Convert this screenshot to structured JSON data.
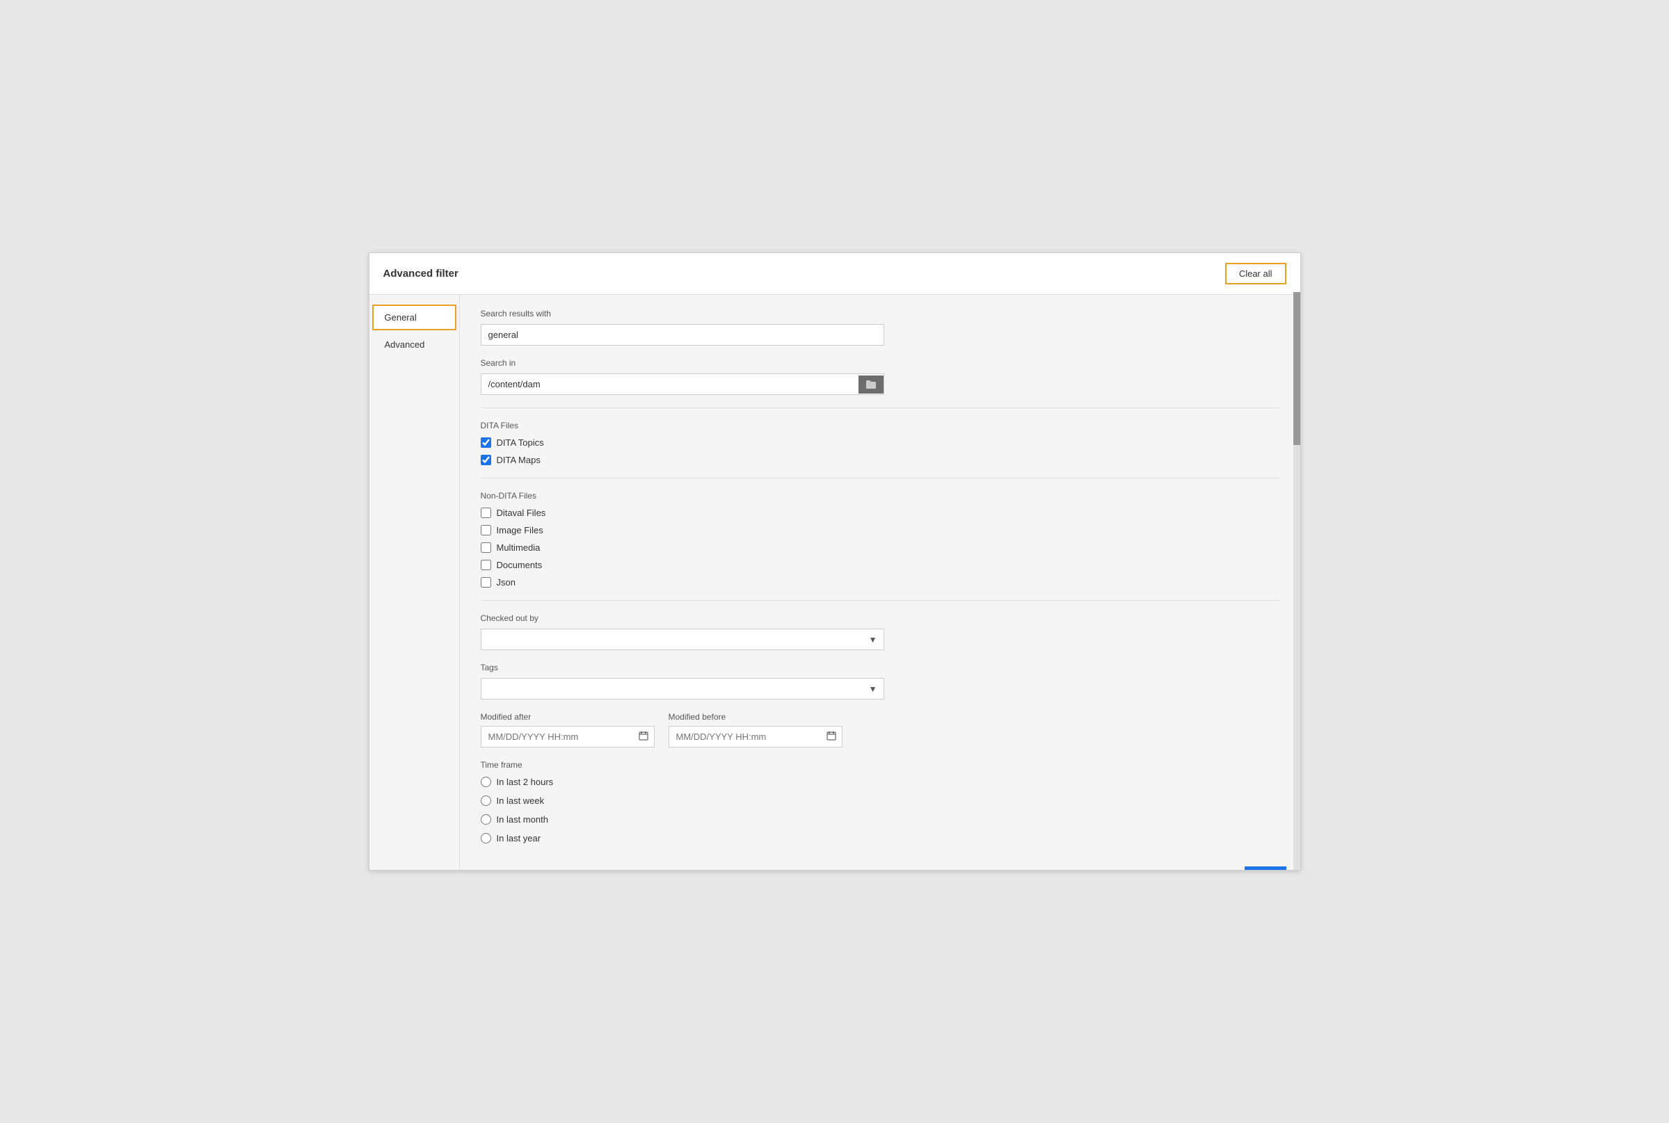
{
  "dialog": {
    "title": "Advanced filter",
    "clear_all_label": "Clear all"
  },
  "sidebar": {
    "items": [
      {
        "id": "general",
        "label": "General",
        "active": true
      },
      {
        "id": "advanced",
        "label": "Advanced",
        "active": false
      }
    ]
  },
  "general": {
    "search_results_label": "Search results with",
    "search_results_value": "general",
    "search_in_label": "Search in",
    "search_in_value": "/content/dam",
    "dita_files_label": "DITA Files",
    "dita_topics_label": "DITA Topics",
    "dita_topics_checked": true,
    "dita_maps_label": "DITA Maps",
    "dita_maps_checked": true,
    "non_dita_label": "Non-DITA Files",
    "non_dita_items": [
      {
        "id": "ditaval",
        "label": "Ditaval Files",
        "checked": false
      },
      {
        "id": "image",
        "label": "Image Files",
        "checked": false
      },
      {
        "id": "multimedia",
        "label": "Multimedia",
        "checked": false
      },
      {
        "id": "documents",
        "label": "Documents",
        "checked": false
      },
      {
        "id": "json",
        "label": "Json",
        "checked": false
      }
    ],
    "checked_out_by_label": "Checked out by",
    "checked_out_placeholder": "",
    "tags_label": "Tags",
    "tags_placeholder": "",
    "modified_after_label": "Modified after",
    "modified_after_placeholder": "MM/DD/YYYY HH:mm",
    "modified_before_label": "Modified before",
    "modified_before_placeholder": "MM/DD/YYYY HH:mm",
    "time_frame_label": "Time frame",
    "time_frame_options": [
      {
        "id": "2hours",
        "label": "In last 2 hours"
      },
      {
        "id": "week",
        "label": "In last week"
      },
      {
        "id": "month",
        "label": "In last month"
      },
      {
        "id": "year",
        "label": "In last year"
      }
    ]
  },
  "footer": {
    "blue_bar": true
  }
}
